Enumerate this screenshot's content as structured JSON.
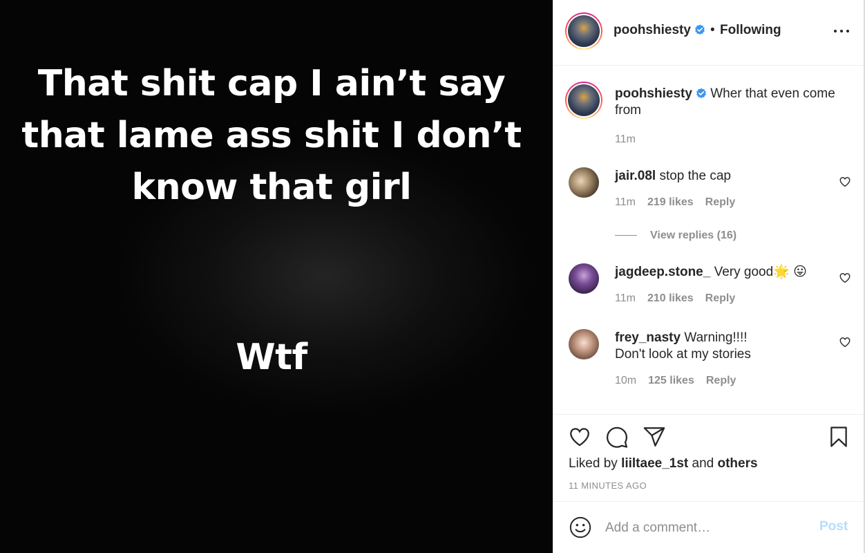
{
  "post_image": {
    "lines": [
      "That shit cap I ain’t say",
      "that lame ass shit I don’t",
      "know that girl"
    ],
    "bottom_text": "Wtf"
  },
  "header": {
    "username": "poohshiesty",
    "dot": "•",
    "follow_status": "Following"
  },
  "caption": {
    "username": "poohshiesty",
    "text": "Wher that even come from",
    "time": "11m"
  },
  "comments": [
    {
      "username": "jair.08l",
      "text": "stop the cap",
      "time": "11m",
      "likes": "219 likes",
      "reply": "Reply"
    },
    {
      "username": "jagdeep.stone_",
      "text": "Very good🌟 😛",
      "time": "11m",
      "likes": "210 likes",
      "reply": "Reply"
    },
    {
      "username": "frey_nasty",
      "text": "Warning!!!! Don't look at my stories",
      "time": "10m",
      "likes": "125 likes",
      "reply": "Reply"
    }
  ],
  "view_replies": "View replies (16)",
  "liked_by": {
    "prefix": "Liked by",
    "user": "liiltaee_1st",
    "middle": "and",
    "others": "others"
  },
  "timestamp": "11 MINUTES AGO",
  "add_comment": {
    "placeholder": "Add a comment…",
    "post_label": "Post"
  },
  "colors": {
    "verified": "#3897f0",
    "post_button": "#b2dffc",
    "secondary_text": "#8e8e8e"
  }
}
